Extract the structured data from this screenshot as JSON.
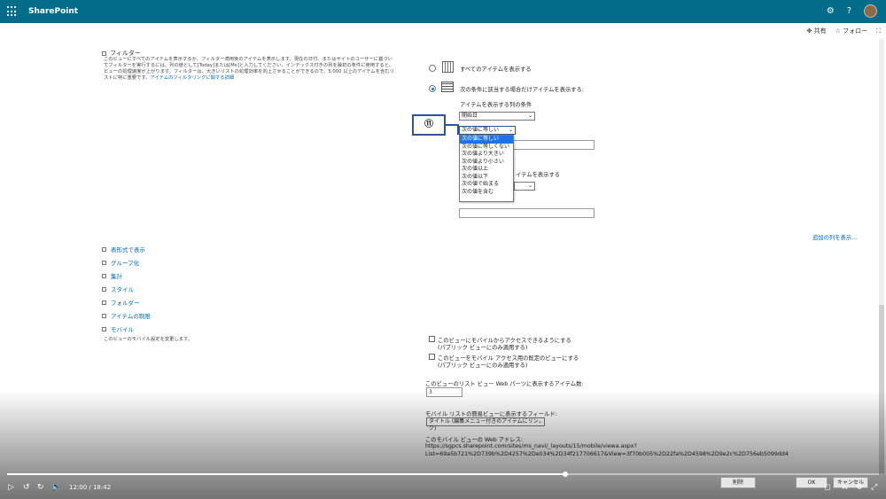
{
  "app": {
    "name": "SharePoint"
  },
  "header": {
    "share": "共有",
    "follow": "フォロー"
  },
  "filter": {
    "section_title": "フィルター",
    "description": "このビューにすべてのアイテムを表示するか、フィルター適用後のアイテムを表示します。現在の日付、またはサイトのユーザーに基づいてフィルターを実行するには、列の値として[Today]または[Me]と入力してください。インデックス付きの列を最初の条件に使用すると、ビューの処理速度が上がります。フィルターは、大きいリストの処理効率を向上させることができるので、5,000 以上のアイテムを含むリストに特に重要です。",
    "link_text": "アイテムのフィルタリングに関する詳細",
    "show_all_label": "すべてのアイテムを表示する",
    "show_conditional_label": "次の条件に該当する場合だけアイテムを表示する:",
    "condition_heading": "アイテムを表示する列の条件",
    "column_select": "開始日",
    "operator_select": "次の値に等しい",
    "operator_options": [
      "次の値に等しい",
      "次の値に等しくない",
      "次の値より大きい",
      "次の値より小さい",
      "次の値以上",
      "次の値以下",
      "次の値で始まる",
      "次の値を含む"
    ],
    "partial_label": "イテムを表示する",
    "callout_number": "⑪"
  },
  "more_columns_link": "追加の列を表示...",
  "sections": [
    "表形式で表示",
    "グループ化",
    "集計",
    "スタイル",
    "フォルダー",
    "アイテムの制限",
    "モバイル"
  ],
  "mobile": {
    "description": "このビューのモバイル設定を変更します。",
    "checkbox1": "このビューにモバイルからアクセスできるようにする",
    "checkbox1_sub": "(パブリック ビューにのみ適用する)",
    "checkbox2": "このビューをモバイル アクセス用の既定のビューにする",
    "checkbox2_sub": "(パブリック ビューにのみ適用する)",
    "item_count_label": "このビューのリスト ビュー Web パーツに表示するアイテム数:",
    "item_count_value": "3",
    "field_label": "モバイル リストの簡易ビューに表示するフィールド:",
    "field_value": "タイトル (編集メニュー付きのアイテムにリンク)",
    "address_label": "このモバイル ビューの Web アドレス:",
    "address_line1": "https://sgpcs.sharepoint.com/sites/ms_navi/_layouts/15/mobile/viewa.aspx?",
    "address_line2": "List=69a5b721%2D739b%2D4257%2De034%2D34f217706617&View=3f70b005%2D22fa%2D4598%2D9e2c%2D756eb5099dd4"
  },
  "buttons": {
    "delete": "削除",
    "ok": "OK",
    "cancel": "キャンセル"
  },
  "player": {
    "time": "12:00 / 18:42",
    "progress": 0.64
  }
}
